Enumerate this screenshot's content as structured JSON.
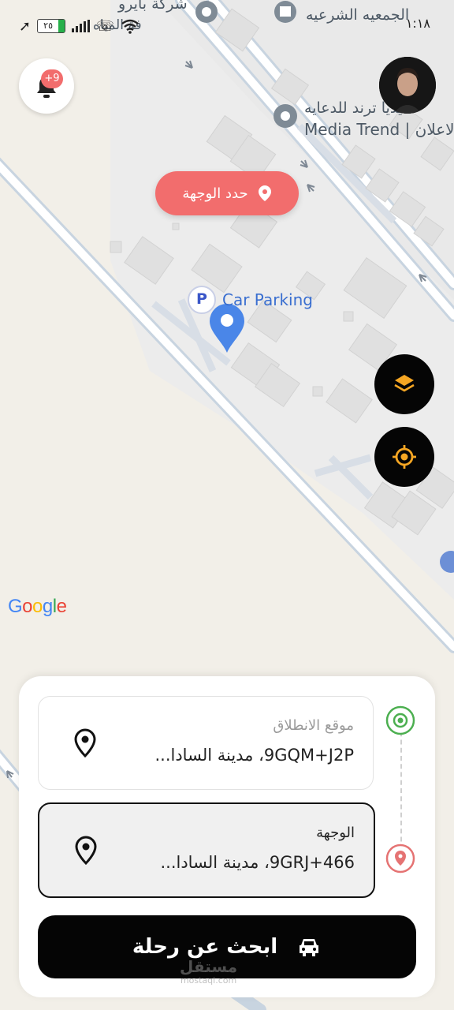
{
  "status_bar": {
    "time": "١:١٨",
    "battery": "٢٥"
  },
  "notifications": {
    "badge": "+9"
  },
  "map": {
    "poi_car_parking": "Car Parking",
    "poi_car_parking_letter": "P",
    "poi_media_trend_ar": "ميديا ترند للدعايه",
    "poi_media_trend_en": "Media Trend | لاعلان",
    "poi_gamaeya": "الجمعيه الشرعيه",
    "poi_bayro": "شركة بايرو",
    "poi_bayro_2": "فة المياه",
    "set_destination_label": "حدد الوجهة",
    "google_logo": [
      "G",
      "o",
      "o",
      "g",
      "l",
      "e"
    ]
  },
  "trip": {
    "origin_label": "موقع الانطلاق",
    "origin_value": "9GQM+J2P، مدينة السادا...",
    "destination_label": "الوجهة",
    "destination_value": "9GRJ+466، مدينة السادا...",
    "search_button": "ابحث عن رحلة"
  },
  "watermark": {
    "text": "مستقل",
    "sub": "mostaql.com"
  },
  "colors": {
    "accent": "#f26d6d",
    "origin_green": "#4caf50",
    "dest_red": "#e57373",
    "fab_icon": "#f5a623"
  }
}
